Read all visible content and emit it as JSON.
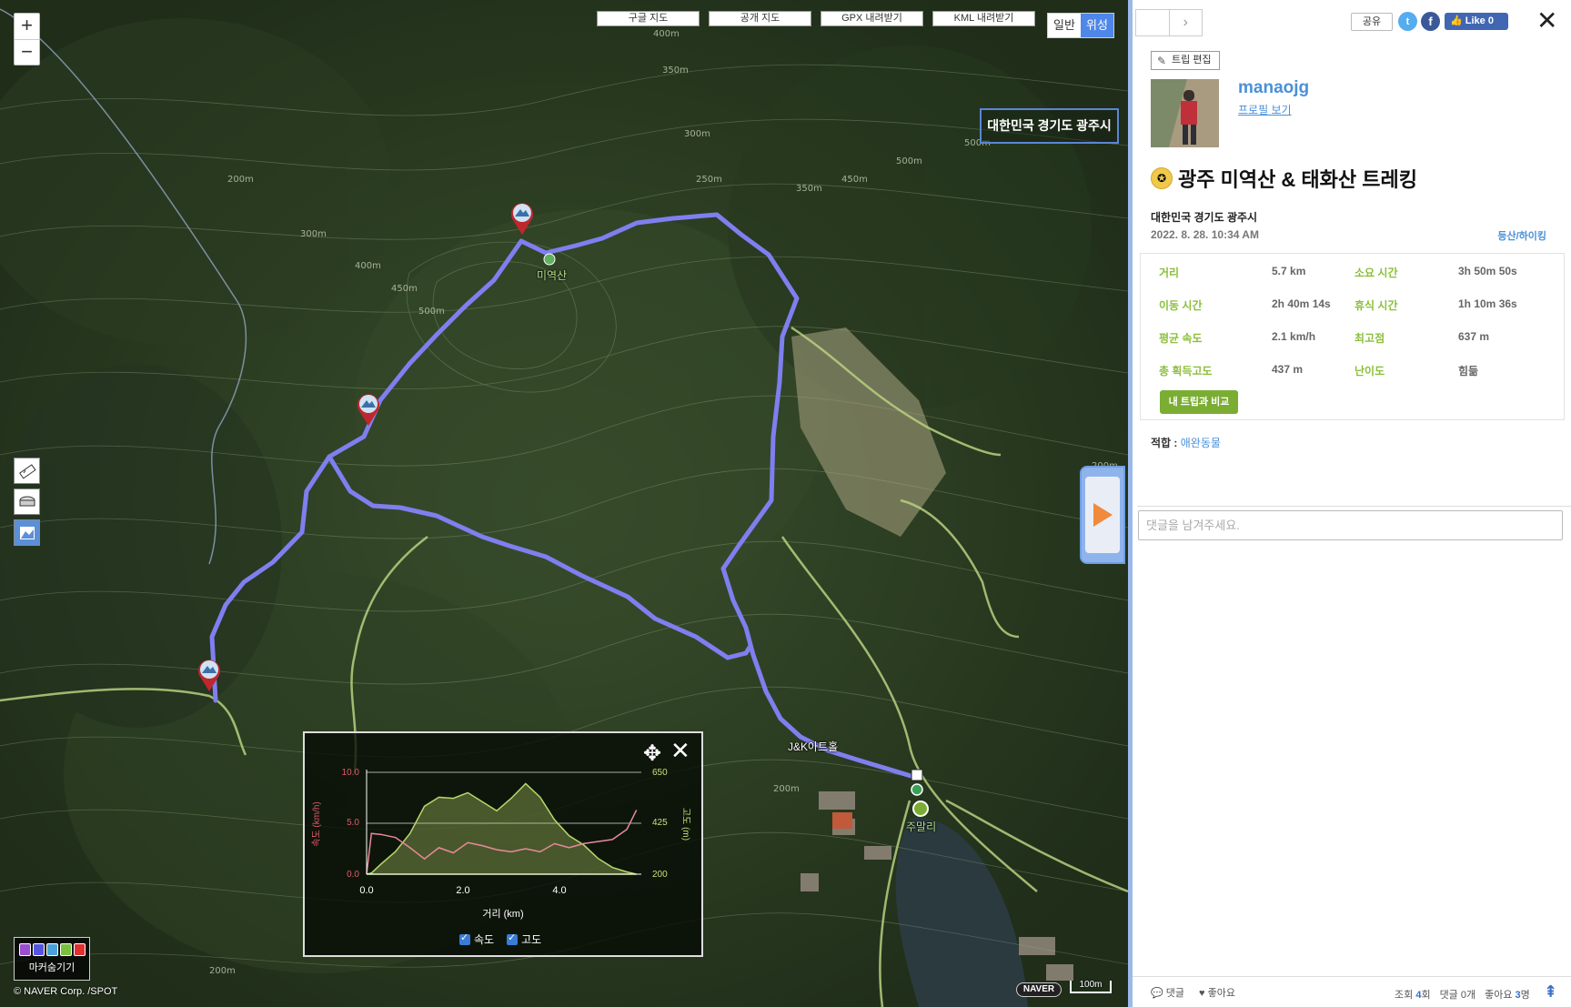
{
  "map": {
    "zoom_in": "+",
    "zoom_out": "−",
    "buttons": [
      "구글 지도",
      "공개 지도",
      "GPX 내려받기",
      "KML 내려받기"
    ],
    "type_normal": "일반",
    "type_satellite": "위성",
    "region_label": "대한민국 경기도 광주시",
    "peak_label": "미역산",
    "place_label": "J&K아트홀",
    "start_label": "주말리",
    "contour_labels": [
      "400m",
      "350m",
      "300m",
      "250m",
      "200m",
      "450m",
      "500m"
    ],
    "marker_hide_label": "마커숨기기",
    "copyright": "© NAVER Corp. /SPOT",
    "naver": "NAVER",
    "scale": "100m"
  },
  "elevation_chart": {
    "xlabel": "거리 (km)",
    "ylabel_left": "속도 (km/h)",
    "ylabel_right": "고도 (m)",
    "left_ticks": [
      "10.0",
      "5.0",
      "0.0"
    ],
    "right_ticks": [
      "650",
      "425",
      "200"
    ],
    "x_ticks": [
      "0.0",
      "2.0",
      "4.0"
    ],
    "legend_speed": "속도",
    "legend_elev": "고도",
    "colors": {
      "speed": "#e88a9a",
      "elevation": "#b8d86a",
      "left_axis": "#e05a6a",
      "right_axis": "#c8e07a"
    }
  },
  "chart_data": {
    "type": "line",
    "xlabel": "거리 (km)",
    "ylabel": "속도 (km/h)",
    "ylabel_right": "고도 (m)",
    "xlim": [
      0,
      5.7
    ],
    "ylim": [
      0,
      10
    ],
    "ylim_right": [
      200,
      650
    ],
    "x": [
      0.0,
      0.1,
      0.3,
      0.6,
      0.9,
      1.2,
      1.5,
      1.8,
      2.1,
      2.4,
      2.7,
      3.0,
      3.3,
      3.6,
      3.9,
      4.2,
      4.5,
      4.8,
      5.1,
      5.4,
      5.6
    ],
    "series": [
      {
        "name": "속도",
        "axis": "left",
        "values": [
          0.0,
          4.0,
          3.9,
          3.6,
          2.6,
          1.5,
          2.6,
          2.1,
          3.1,
          2.8,
          2.4,
          2.2,
          2.5,
          2.2,
          3.0,
          2.6,
          3.0,
          3.2,
          3.4,
          4.4,
          6.3
        ]
      },
      {
        "name": "고도",
        "axis": "left_right",
        "values": [
          200,
          205,
          245,
          300,
          380,
          500,
          540,
          535,
          560,
          520,
          480,
          535,
          600,
          540,
          440,
          370,
          330,
          270,
          230,
          210,
          200
        ]
      }
    ]
  },
  "panel": {
    "share": "공유",
    "twitter": "t",
    "facebook": "f",
    "like": "👍 Like 0",
    "edit_trip": "트립 편집",
    "username": "manaojg",
    "profile_link": "프로필 보기",
    "title": "광주 미역산 & 태화산 트레킹",
    "region": "대한민국 경기도 광주시",
    "date": "2022. 8. 28. 10:34 AM",
    "category": "등산/하이킹",
    "stats": [
      {
        "label": "거리",
        "value": "5.7 km",
        "label2": "소요 시간",
        "value2": "3h 50m 50s"
      },
      {
        "label": "이동 시간",
        "value": "2h 40m 14s",
        "label2": "휴식 시간",
        "value2": "1h 10m 36s"
      },
      {
        "label": "평균 속도",
        "value": "2.1 km/h",
        "label2": "최고점",
        "value2": "637 m"
      },
      {
        "label": "총 획득고도",
        "value": "437 m",
        "label2": "난이도",
        "value2": "힘듦"
      }
    ],
    "compare_btn": "내 트립과 비교",
    "suitable_label": "적합 :",
    "suitable_value": "애완동물",
    "comment_placeholder": "댓글을 남겨주세요.",
    "footer": {
      "comments": "댓글",
      "likes": "좋아요",
      "views_label": "조회",
      "views_count": "4",
      "views_unit": "회",
      "comment_count": "댓글 0개",
      "likes_label": "좋아요",
      "likes_count": "3",
      "likes_unit": "명"
    }
  }
}
